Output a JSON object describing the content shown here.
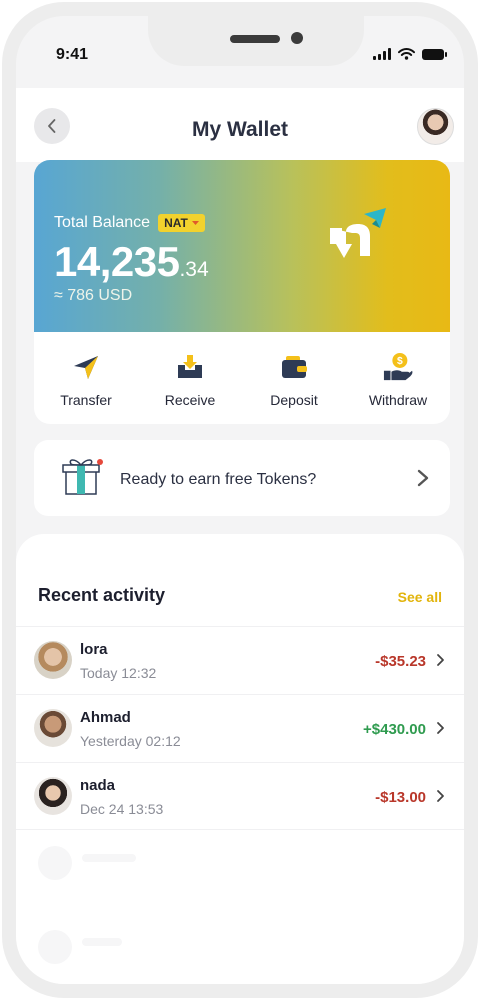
{
  "status_bar": {
    "time": "9:41"
  },
  "header": {
    "title": "My Wallet",
    "back_icon": "chevron-left-icon",
    "avatar": "profile-avatar"
  },
  "balance": {
    "label": "Total Balance",
    "currency": "NAT",
    "amount_main": "14,235",
    "amount_decimal": ".34",
    "fiat": "≈ 786 USD",
    "gradient_start": "#58a6d3",
    "gradient_end": "#e8b915"
  },
  "actions": [
    {
      "label": "Transfer",
      "icon": "paper-plane-icon"
    },
    {
      "label": "Receive",
      "icon": "inbox-download-icon"
    },
    {
      "label": "Deposit",
      "icon": "wallet-icon"
    },
    {
      "label": "Withdraw",
      "icon": "hand-coin-icon"
    }
  ],
  "promo": {
    "text": "Ready to earn free Tokens?",
    "icon": "gift-icon"
  },
  "activity": {
    "title": "Recent activity",
    "see_all": "See all",
    "items": [
      {
        "name": "lora",
        "date": "Today 12:32",
        "amount": "-$35.23",
        "direction": "out"
      },
      {
        "name": "Ahmad",
        "date": "Yesterday 02:12",
        "amount": "+$430.00",
        "direction": "in"
      },
      {
        "name": "nada",
        "date": "Dec 24 13:53",
        "amount": "-$13.00",
        "direction": "out"
      }
    ]
  },
  "colors": {
    "accent": "#e2b40c",
    "negative": "#b9372a",
    "positive": "#2f9b4f",
    "title": "#2b3042"
  }
}
